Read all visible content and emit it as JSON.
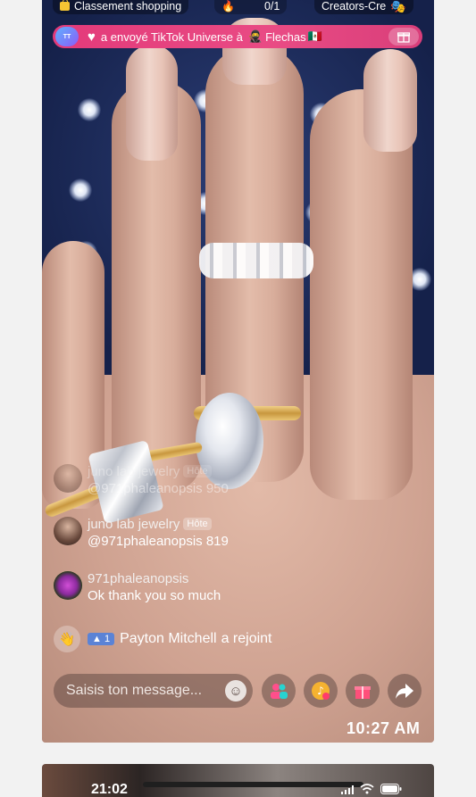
{
  "top_bar": {
    "shopping_label": "Classement shopping",
    "counter": "0/1",
    "creators_label": "Creators-Cre"
  },
  "gift_banner": {
    "badge_text": "TikTok Universe",
    "message": "a envoyé TikTok Universe à",
    "recipient": "Flechas",
    "flag": "🇲🇽"
  },
  "comments": [
    {
      "name": "juno lab jewelry",
      "host_badge": "Hôte",
      "text": "@971phaleanopsis 950",
      "faded": true
    },
    {
      "name": "juno lab jewelry",
      "host_badge": "Hôte",
      "text": "@971phaleanopsis 819",
      "faded": false
    },
    {
      "name": "971phaleanopsis",
      "host_badge": "",
      "text": "Ok thank you so much",
      "faded": false
    }
  ],
  "join_event": {
    "level": "1",
    "user": "Payton Mitchell",
    "action": "a rejoint"
  },
  "composer": {
    "placeholder": "Saisis ton message..."
  },
  "timestamp": "10:27 AM",
  "next_preview": {
    "status_time": "21:02"
  },
  "colors": {
    "banner_pink": "#e33a7a",
    "level_blue": "#5b83d6",
    "board_navy": "#15214a"
  }
}
